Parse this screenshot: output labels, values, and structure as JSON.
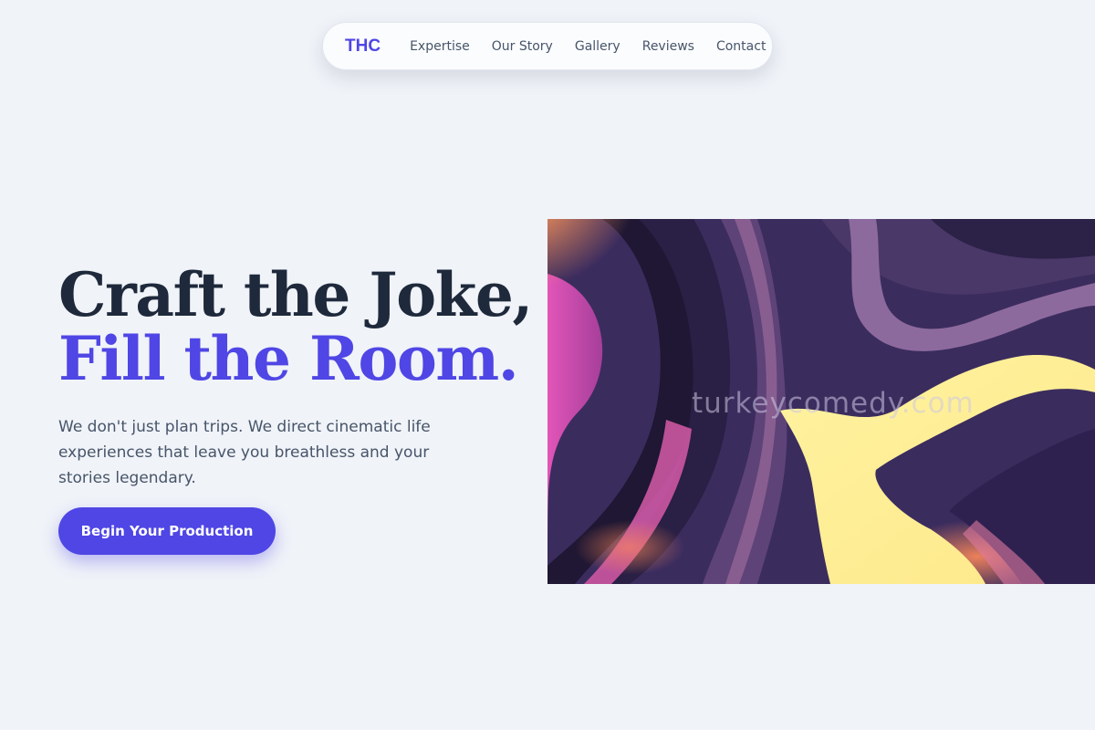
{
  "nav": {
    "logo": "THC",
    "links": [
      {
        "label": "Expertise"
      },
      {
        "label": "Our Story"
      },
      {
        "label": "Gallery"
      },
      {
        "label": "Reviews"
      },
      {
        "label": "Contact"
      }
    ]
  },
  "hero": {
    "title_line1": "Craft the Joke,",
    "title_line2": "Fill the Room.",
    "description": "We don't just plan trips. We direct cinematic life experiences that leave you breathless and your stories legendary.",
    "cta_label": "Begin Your Production",
    "image_watermark": "turkeycomedy.com"
  },
  "colors": {
    "accent": "#4f46e5",
    "heading": "#1e293b",
    "body_text": "#475569",
    "background": "#f0f3f8"
  }
}
